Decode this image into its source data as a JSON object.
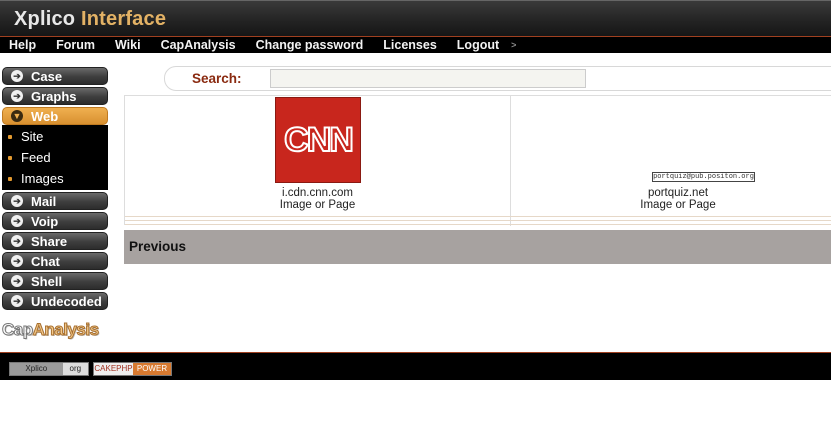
{
  "app": {
    "title_part1": "Xplico",
    "title_part2": "Interface"
  },
  "topnav": {
    "items": [
      "Help",
      "Forum",
      "Wiki",
      "CapAnalysis",
      "Change password",
      "Licenses",
      "Logout"
    ],
    "separator": ">"
  },
  "sidebar": {
    "items": [
      {
        "label": "Case",
        "icon": "arrow-right-icon"
      },
      {
        "label": "Graphs",
        "icon": "arrow-right-icon"
      },
      {
        "label": "Web",
        "icon": "arrow-down-icon",
        "active": true
      },
      {
        "label": "Mail",
        "icon": "arrow-right-icon"
      },
      {
        "label": "Voip",
        "icon": "arrow-right-icon"
      },
      {
        "label": "Share",
        "icon": "arrow-right-icon"
      },
      {
        "label": "Chat",
        "icon": "arrow-right-icon"
      },
      {
        "label": "Shell",
        "icon": "arrow-right-icon"
      },
      {
        "label": "Undecoded",
        "icon": "arrow-right-icon"
      }
    ],
    "submenu": [
      "Site",
      "Feed",
      "Images"
    ],
    "caplogo": {
      "part1": "Cap",
      "part2": "Analysis"
    }
  },
  "search": {
    "label": "Search:",
    "value": ""
  },
  "results": [
    {
      "host": "i.cdn.cnn.com",
      "type": "Image or Page",
      "thumb_text": "CNN"
    },
    {
      "host": "portquiz.net",
      "type": "Image or Page",
      "thumb_text": "portquiz@pub.positon.org"
    }
  ],
  "pager": {
    "previous": "Previous"
  },
  "footer": {
    "xplico_badge": {
      "left": "Xplico",
      "right": "org"
    },
    "cake_badge": {
      "left": "CAKEPHP",
      "right": "POWER"
    }
  },
  "colors": {
    "accent": "#e39a30",
    "header": "#222222",
    "search_label": "#8a2a10",
    "pager_bg": "#a7a2a0"
  }
}
